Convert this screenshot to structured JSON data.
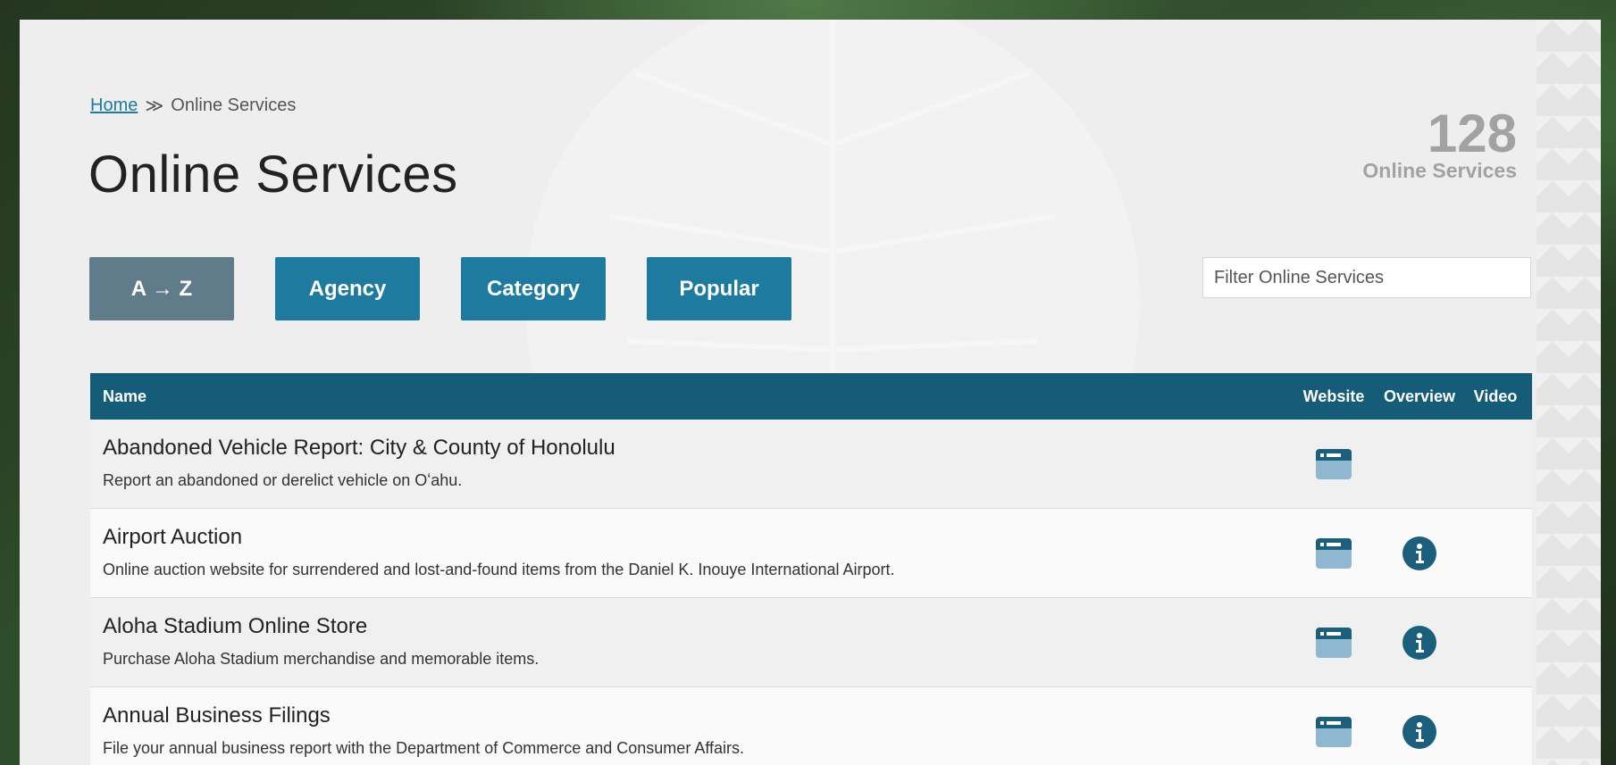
{
  "breadcrumb": {
    "home": "Home",
    "separator": "≫",
    "current": "Online Services"
  },
  "page_title": "Online Services",
  "summary": {
    "count": "128",
    "label": "Online Services"
  },
  "tabs": [
    {
      "label": "A → Z",
      "active": true
    },
    {
      "label": "Agency",
      "active": false
    },
    {
      "label": "Category",
      "active": false
    },
    {
      "label": "Popular",
      "active": false
    }
  ],
  "filter": {
    "placeholder": "Filter Online Services",
    "value": ""
  },
  "table": {
    "headers": {
      "name": "Name",
      "website": "Website",
      "overview": "Overview",
      "video": "Video"
    },
    "rows": [
      {
        "title": "Abandoned Vehicle Report: City & County of Honolulu",
        "description": "Report an abandoned or derelict vehicle on Oʻahu.",
        "website_icon": "browser-window-icon",
        "overview_icon": null
      },
      {
        "title": "Airport Auction",
        "description": "Online auction website for surrendered and lost-and-found items from the Daniel K. Inouye International Airport.",
        "website_icon": "browser-window-icon",
        "overview_icon": "info-icon"
      },
      {
        "title": "Aloha Stadium Online Store",
        "description": "Purchase Aloha Stadium merchandise and memorable items.",
        "website_icon": "browser-window-icon",
        "overview_icon": "info-icon"
      },
      {
        "title": "Annual Business Filings",
        "description": "File your annual business report with the Department of Commerce and Consumer Affairs.",
        "website_icon": "browser-window-icon",
        "overview_icon": "info-icon"
      }
    ]
  },
  "colors": {
    "primary": "#1f7aa0",
    "active_tab": "#607b8a",
    "table_header": "#145c78",
    "icon": "#1c5f7c",
    "icon_light": "#8fb8d0"
  }
}
